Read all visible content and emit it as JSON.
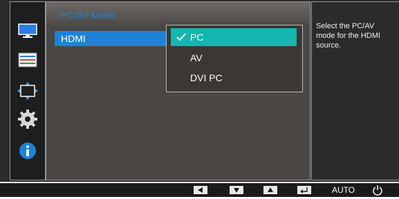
{
  "menu": {
    "title": "PC/AV Mode",
    "selected_item": "HDMI",
    "options": [
      {
        "label": "PC",
        "selected": true
      },
      {
        "label": "AV",
        "selected": false
      },
      {
        "label": "DVI PC",
        "selected": false
      }
    ]
  },
  "help": {
    "text": "Select the PC/AV mode for the HDMI source."
  },
  "sidebar": {
    "icons": [
      "monitor-icon",
      "picture-settings-icon",
      "resize-icon",
      "settings-gear-icon",
      "info-icon"
    ]
  },
  "bottom_bar": {
    "auto_label": "AUTO",
    "buttons": [
      "left-arrow-icon",
      "down-arrow-icon",
      "up-arrow-icon",
      "enter-icon",
      "power-icon"
    ]
  },
  "colors": {
    "highlight_blue": "#1e82d6",
    "selected_teal": "#13b6b0",
    "title_blue": "#1a85d8"
  }
}
